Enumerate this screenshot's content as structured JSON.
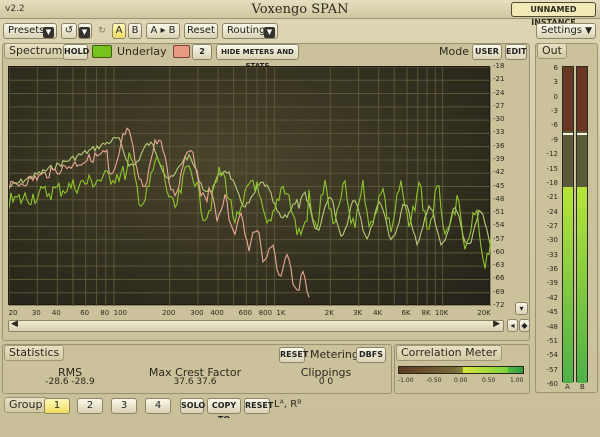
{
  "titlebar": {
    "version": "v2.2",
    "title": "Voxengo SPAN",
    "instance": "UNNAMED INSTANCE"
  },
  "toolbar": {
    "presets": "Presets",
    "ab_a": "A",
    "ab_b": "B",
    "ab_copy": "A ▸ B",
    "reset": "Reset",
    "routing": "Routing",
    "settings": "Settings"
  },
  "spectrum": {
    "label": "Spectrum",
    "hold": "HOLD",
    "underlay": "Underlay",
    "underlay_num": "2",
    "hide_meters": "HIDE METERS AND STATS",
    "mode_label": "Mode",
    "mode_value": "USER",
    "edit": "EDIT",
    "db_ticks": [
      "-18",
      "-21",
      "-24",
      "-27",
      "-30",
      "-33",
      "-36",
      "-39",
      "-42",
      "-45",
      "-48",
      "-51",
      "-54",
      "-57",
      "-60",
      "-63",
      "-66",
      "-69",
      "-72"
    ],
    "freq_ticks": [
      "20",
      "30",
      "40",
      "60",
      "80",
      "100",
      "200",
      "300",
      "400",
      "600",
      "800",
      "1K",
      "2K",
      "3K",
      "4K",
      "6K",
      "8K",
      "10K",
      "20K"
    ]
  },
  "out": {
    "label": "Out",
    "scale": [
      "6",
      "3",
      "0",
      "-3",
      "-6",
      "-9",
      "-12",
      "-15",
      "-18",
      "-21",
      "-24",
      "-27",
      "-30",
      "-33",
      "-36",
      "-39",
      "-42",
      "-45",
      "-48",
      "-51",
      "-54",
      "-57",
      "-60"
    ],
    "channel_a": "A",
    "channel_b": "B"
  },
  "statistics": {
    "label": "Statistics",
    "reset": "RESET",
    "metering_label": "Metering",
    "metering_value": "DBFS",
    "rms_title": "RMS",
    "rms_values": "-28.6  -28.9",
    "crest_title": "Max Crest Factor",
    "crest_values": "37.6  37.6",
    "clip_title": "Clippings",
    "clip_values": "0    0"
  },
  "correlation": {
    "label": "Correlation Meter",
    "ticks": [
      "-1.00",
      "-0.50",
      "0.00",
      "0.50",
      "1.00"
    ]
  },
  "group": {
    "label": "Group",
    "g1": "1",
    "g2": "2",
    "g3": "3",
    "g4": "4",
    "solo": "SOLO",
    "copy_to": "COPY TO",
    "reset": "RESET",
    "routing_indicator": "Lᴬ, Rᴮ"
  },
  "colors": {
    "accent_yellow": "#f1dc5f",
    "underlay_swatch": "#e89a85",
    "hold_swatch": "#78c21f",
    "trace_green": "#8fc52c",
    "trace_pale": "#b8cb7b",
    "trace_salmon": "#e9a894"
  }
}
